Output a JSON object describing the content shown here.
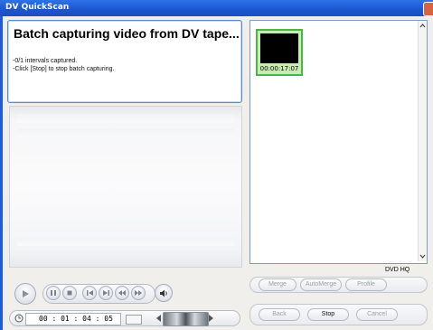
{
  "window": {
    "title": "DV QuickScan"
  },
  "status": {
    "heading": "Batch capturing video from DV tape...",
    "line1": "-0/1 intervals captured.",
    "line2": "-Click [Stop] to stop batch capturing."
  },
  "timecode": {
    "value": "00 : 01 : 04 : 05"
  },
  "thumbnails": [
    {
      "timecode": "00:00:17:07"
    }
  ],
  "quality": {
    "label": "DVD HQ"
  },
  "buttons": {
    "merge": "Merge",
    "automerge": "AutoMerge",
    "profile": "Profile",
    "back": "Back",
    "stop": "Stop",
    "cancel": "Cancel"
  },
  "icons": [
    "play-icon",
    "pause-icon",
    "stop-icon",
    "prev-frame-icon",
    "next-frame-icon",
    "rewind-icon",
    "fast-forward-icon",
    "volume-icon",
    "clock-icon"
  ]
}
